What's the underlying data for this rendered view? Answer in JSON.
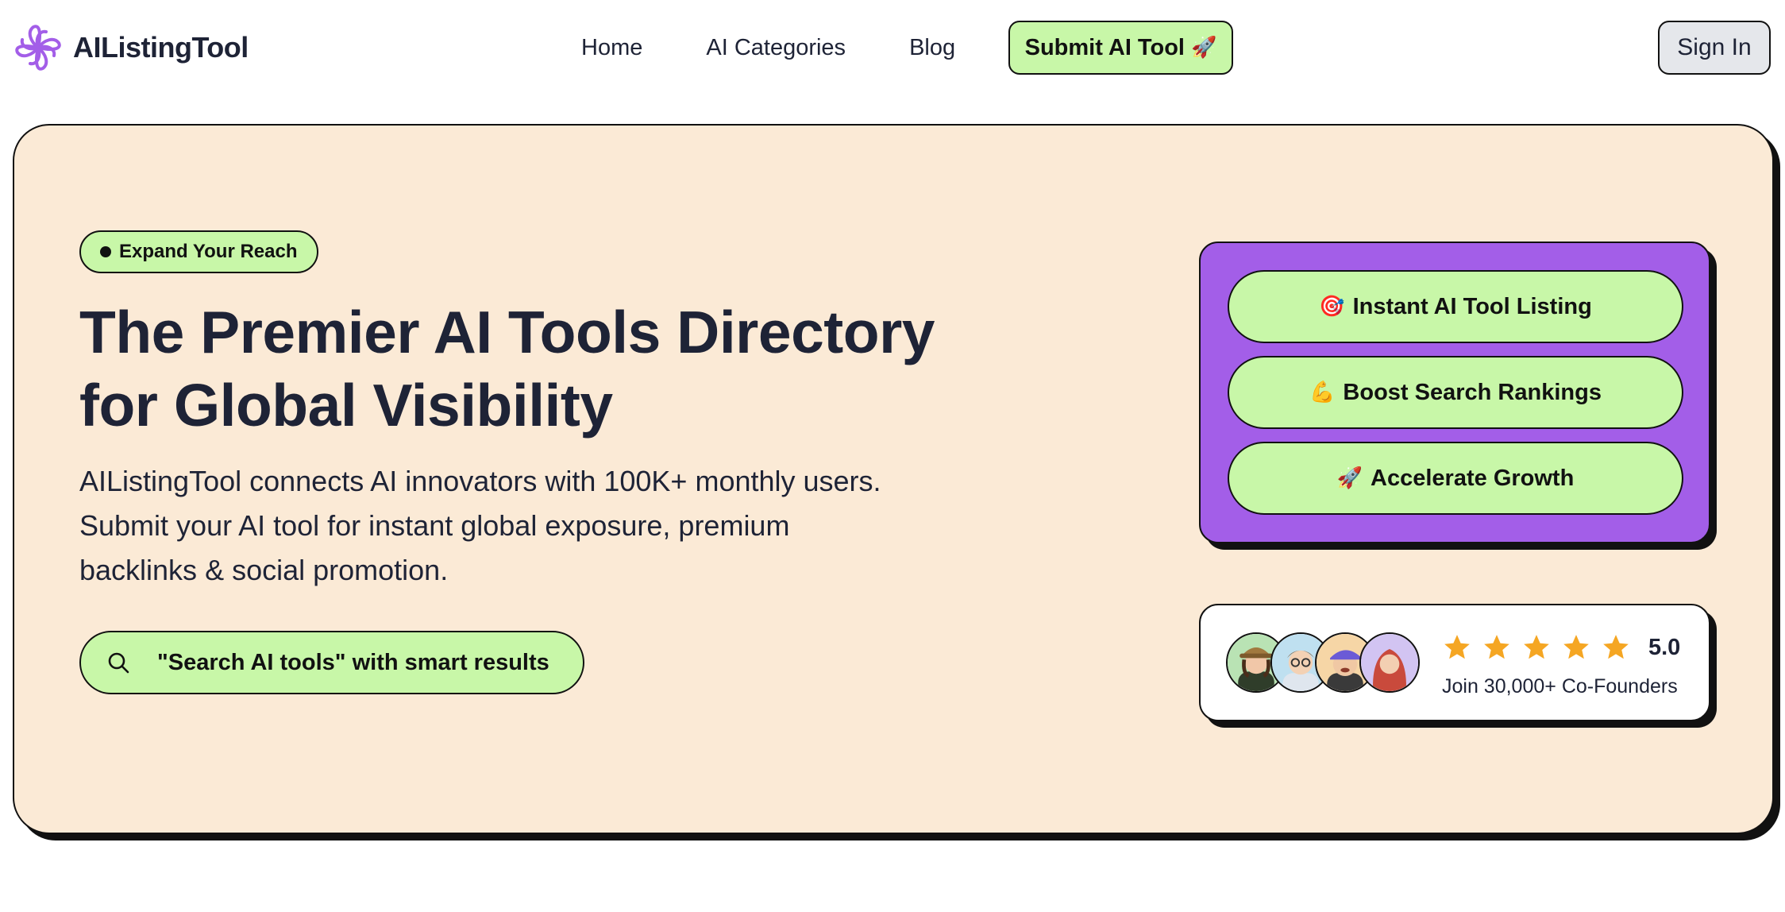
{
  "brand": {
    "name": "AIListingTool",
    "accent": "#a35ee8"
  },
  "nav": {
    "links": [
      {
        "label": "Home"
      },
      {
        "label": "AI Categories"
      },
      {
        "label": "Blog"
      }
    ],
    "submit_label": "Submit AI Tool",
    "submit_icon": "rocket-icon",
    "signin_label": "Sign In"
  },
  "hero": {
    "pill_label": "Expand Your Reach",
    "title_line1": "The Premier AI Tools Directory",
    "title_line2": "for Global Visibility",
    "description": "AIListingTool connects AI innovators with 100K+ monthly users. Submit your AI tool for instant global exposure, premium backlinks & social promotion.",
    "search_label": "\"Search AI tools\" with smart results",
    "background": "#fbead6",
    "button_color": "#c8f7a8"
  },
  "features": [
    {
      "label": "Instant AI Tool Listing",
      "icon": "target-icon"
    },
    {
      "label": "Boost Search Rankings",
      "icon": "muscle-icon"
    },
    {
      "label": "Accelerate Growth",
      "icon": "rocket-icon"
    }
  ],
  "rating": {
    "score": "5.0",
    "stars": 5,
    "star_color": "#f5a623",
    "join_text": "Join 30,000+ Co-Founders",
    "avatars": [
      "avatar-woman-hat",
      "avatar-man-glasses",
      "avatar-man-cap",
      "avatar-woman-hijab"
    ]
  }
}
